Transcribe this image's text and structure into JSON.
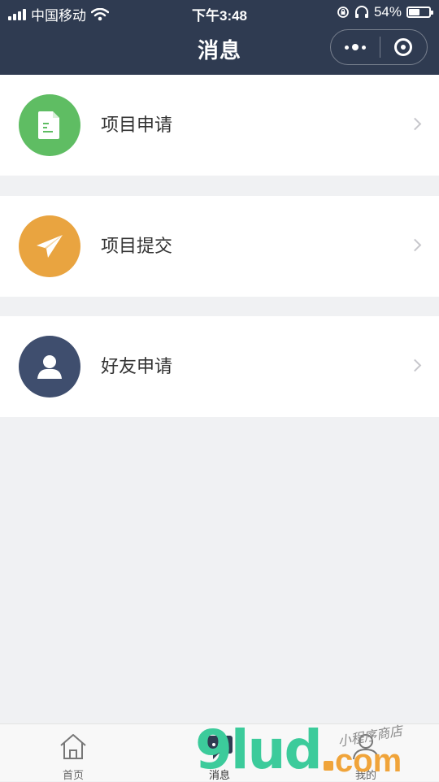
{
  "status_bar": {
    "carrier": "中国移动",
    "time": "下午3:48",
    "battery": "54%",
    "battery_level": 0.54
  },
  "nav": {
    "title": "消息",
    "more_icon": "more-dots-icon",
    "close_icon": "miniprogram-close-icon"
  },
  "list": {
    "items": [
      {
        "label": "项目申请",
        "icon": "document-icon",
        "color": "#5fbd63"
      },
      {
        "label": "项目提交",
        "icon": "paper-plane-icon",
        "color": "#e9a440"
      },
      {
        "label": "好友申请",
        "icon": "user-icon",
        "color": "#3f4e6e"
      }
    ]
  },
  "tabbar": {
    "tabs": [
      {
        "label": "首页",
        "icon": "home-icon"
      },
      {
        "label": "消息",
        "icon": "message-icon"
      },
      {
        "label": "我的",
        "icon": "profile-icon"
      }
    ],
    "active": 1
  },
  "watermark": {
    "brand": "9lud",
    "domain": "com",
    "script": "小程序商店"
  },
  "colors": {
    "header": "#2f3b51",
    "background": "#f0f1f3",
    "accent_green": "#5fbd63",
    "accent_orange": "#e9a440",
    "accent_navy": "#3f4e6e"
  }
}
